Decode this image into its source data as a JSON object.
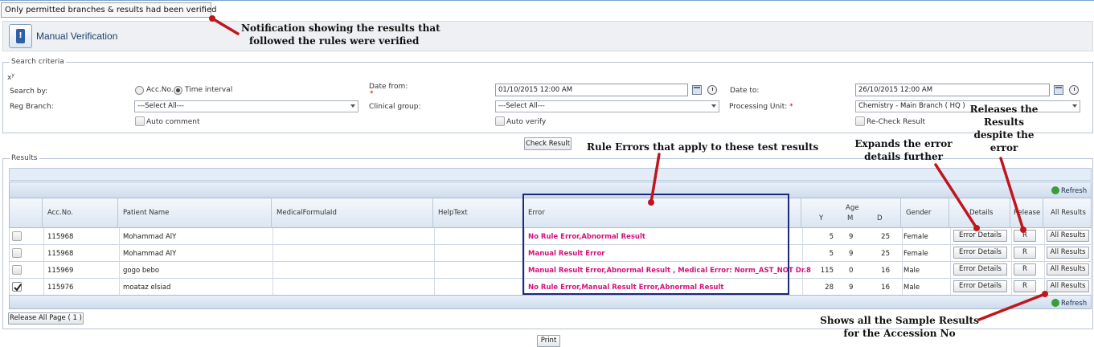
{
  "notification": "Only permitted branches & results had been verified",
  "page_title": "Manual Verification",
  "search": {
    "legend": "Search criteria",
    "xy": "x",
    "xy_sup": "y",
    "search_by_label": "Search by:",
    "radio_acc": "Acc.No.",
    "radio_time": "Time interval",
    "date_from_label": "Date from:",
    "date_from_value": "01/10/2015 12:00 AM",
    "date_to_label": "Date to:",
    "date_to_value": "26/10/2015 12:00 AM",
    "reg_branch_label": "Reg Branch:",
    "reg_branch_value": "---Select All---",
    "clinical_group_label": "Clinical group:",
    "clinical_group_value": "---Select All---",
    "processing_unit_label": "Processing Unit:",
    "processing_unit_value": "Chemistry - Main Branch ( HQ )",
    "auto_comment": "Auto comment",
    "auto_verify": "Auto verify",
    "recheck": "Re-Check Result",
    "required_mark": "*",
    "check_result_button": "Check Result"
  },
  "results": {
    "legend": "Results",
    "refresh": "Refresh",
    "columns": {
      "acc": "Acc.No.",
      "patient": "Patient Name",
      "formula": "MedicalFormulaId",
      "help": "HelpText",
      "error": "Error",
      "age": "Age",
      "y": "Y",
      "m": "M",
      "d": "D",
      "gender": "Gender",
      "details": "Details",
      "release": "Release",
      "all": "All Results"
    },
    "rows": [
      {
        "acc": "115968",
        "patient": "Mohammad AlY",
        "error": "No Rule Error,Abnormal Result",
        "y": "5",
        "m": "9",
        "d": "25",
        "gender": "Female",
        "details": "Error Details",
        "release": "R",
        "all": "All Results",
        "checked": false
      },
      {
        "acc": "115968",
        "patient": "Mohammad AlY",
        "error": "Manual Result Error",
        "y": "5",
        "m": "9",
        "d": "25",
        "gender": "Female",
        "details": "Error Details",
        "release": "R",
        "all": "All Results",
        "checked": false
      },
      {
        "acc": "115969",
        "patient": "gogo bebo",
        "error": "Manual Result Error,Abnormal Result , Medical Error: Norm_AST_NOT Dr.8",
        "y": "115",
        "m": "0",
        "d": "16",
        "gender": "Male",
        "details": "Error Details",
        "release": "R",
        "all": "All Results",
        "checked": false
      },
      {
        "acc": "115976",
        "patient": "moataz elsiad",
        "error": "No Rule Error,Manual Result Error,Abnormal Result",
        "y": "28",
        "m": "9",
        "d": "16",
        "gender": "Male",
        "details": "Error Details",
        "release": "R",
        "all": "All Results",
        "checked": true
      }
    ],
    "release_all": "Release All Page ( 1 )",
    "print": "Print"
  },
  "annotations": {
    "notification_1": "Notification showing the results that",
    "notification_2": "followed the rules were verified",
    "rule_errors": "Rule Errors that apply to these test results",
    "expands_1": "Expands the error",
    "expands_2": "details further",
    "releases_1": "Releases the",
    "releases_2": "Results",
    "releases_3": "despite the",
    "releases_4": "error",
    "shows_1": "Shows all the Sample Results",
    "shows_2": "for the Accession No"
  },
  "colors": {
    "annotation_arrow": "#c0161d",
    "error_text": "#d3127a",
    "error_frame": "#1b2a7a"
  },
  "icons": [
    "app-icon",
    "calendar-icon",
    "clock-icon",
    "refresh-icon",
    "checkmark-icon"
  ]
}
